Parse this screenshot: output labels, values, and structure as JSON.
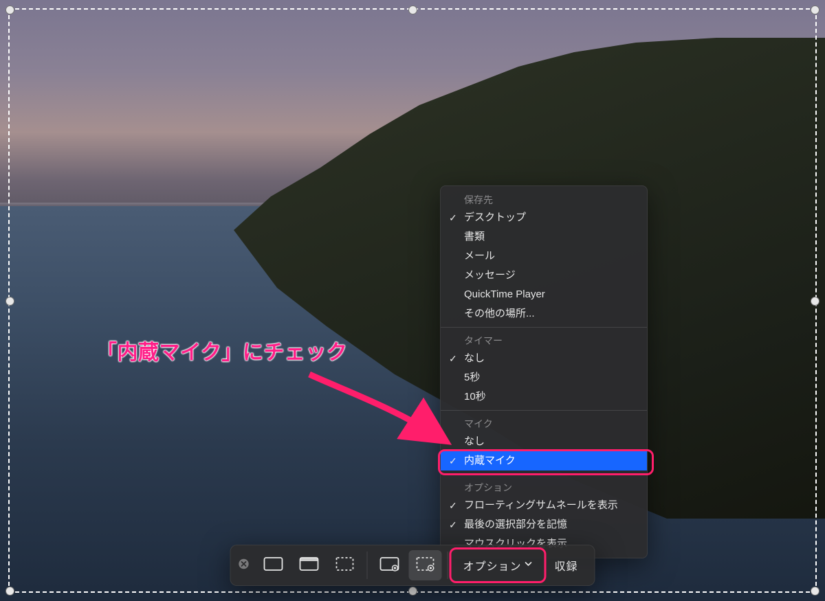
{
  "annotation": {
    "callout": "「内蔵マイク」にチェック",
    "arrow_color": "#ff1e6b"
  },
  "options_menu": {
    "groups": [
      {
        "title": "保存先",
        "items": [
          {
            "label": "デスクトップ",
            "checked": true,
            "selected": false
          },
          {
            "label": "書類",
            "checked": false,
            "selected": false
          },
          {
            "label": "メール",
            "checked": false,
            "selected": false
          },
          {
            "label": "メッセージ",
            "checked": false,
            "selected": false
          },
          {
            "label": "QuickTime Player",
            "checked": false,
            "selected": false
          },
          {
            "label": "その他の場所...",
            "checked": false,
            "selected": false
          }
        ]
      },
      {
        "title": "タイマー",
        "items": [
          {
            "label": "なし",
            "checked": true,
            "selected": false
          },
          {
            "label": "5秒",
            "checked": false,
            "selected": false
          },
          {
            "label": "10秒",
            "checked": false,
            "selected": false
          }
        ]
      },
      {
        "title": "マイク",
        "items": [
          {
            "label": "なし",
            "checked": false,
            "selected": false
          },
          {
            "label": "内蔵マイク",
            "checked": true,
            "selected": true
          }
        ]
      },
      {
        "title": "オプション",
        "items": [
          {
            "label": "フローティングサムネールを表示",
            "checked": true,
            "selected": false
          },
          {
            "label": "最後の選択部分を記憶",
            "checked": true,
            "selected": false
          },
          {
            "label": "マウスクリックを表示",
            "checked": false,
            "selected": false
          }
        ]
      }
    ]
  },
  "toolbar": {
    "close_label": "閉じる",
    "options_label": "オプション",
    "capture_label": "収録",
    "buttons": [
      {
        "id": "capture-entire-screen",
        "name": "capture-entire-screen-button",
        "active": false
      },
      {
        "id": "capture-window",
        "name": "capture-window-button",
        "active": false
      },
      {
        "id": "capture-selection",
        "name": "capture-selection-button",
        "active": false
      },
      {
        "id": "record-entire-screen",
        "name": "record-entire-screen-button",
        "active": false
      },
      {
        "id": "record-selection",
        "name": "record-selection-button",
        "active": true
      }
    ]
  }
}
